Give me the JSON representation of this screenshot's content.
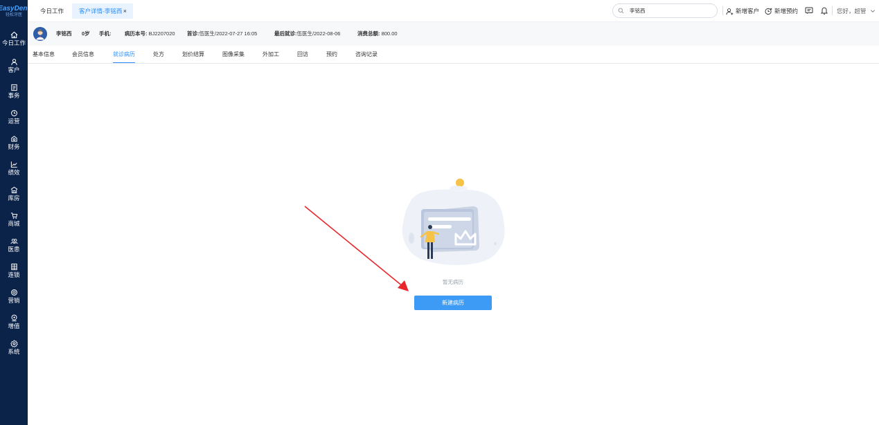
{
  "brand": {
    "name": "EasyDent",
    "subtitle": "轻松牙医"
  },
  "sidebar": {
    "items": [
      {
        "label": "今日工作",
        "icon": "home-icon"
      },
      {
        "label": "客户",
        "icon": "user-icon"
      },
      {
        "label": "事务",
        "icon": "task-icon"
      },
      {
        "label": "运营",
        "icon": "clock-icon"
      },
      {
        "label": "财务",
        "icon": "finance-icon"
      },
      {
        "label": "绩效",
        "icon": "chart-icon"
      },
      {
        "label": "库房",
        "icon": "warehouse-icon"
      },
      {
        "label": "商城",
        "icon": "cart-icon"
      },
      {
        "label": "医患",
        "icon": "users-icon"
      },
      {
        "label": "连锁",
        "icon": "chain-icon"
      },
      {
        "label": "营销",
        "icon": "marketing-icon"
      },
      {
        "label": "增值",
        "icon": "value-added-icon"
      },
      {
        "label": "系统",
        "icon": "gear-icon"
      }
    ]
  },
  "topbar": {
    "tabs": [
      {
        "label": "今日工作",
        "active": false
      },
      {
        "label": "客户详情-李铭西",
        "active": true,
        "close": "×"
      }
    ],
    "search": {
      "value": "李铭西",
      "placeholder": ""
    },
    "add_customer": "新增客户",
    "add_appointment": "新增预约",
    "greeting": "您好，超管"
  },
  "patient": {
    "name": "李铭西",
    "age": "0岁",
    "phone_label": "手机:",
    "phone_value": "",
    "record_no_label": "病历本号:",
    "record_no": "BJ2207020",
    "first_visit_label": "首诊:",
    "first_visit": "伍医生/2022-07-27 16:05",
    "last_visit_label": "最后就诊:",
    "last_visit": "伍医生/2022-08-06",
    "total_spend_label": "消费总额:",
    "total_spend": "800.00"
  },
  "subtabs": [
    {
      "label": "基本信息",
      "active": false
    },
    {
      "label": "会员信息",
      "active": false
    },
    {
      "label": "就诊病历",
      "active": true
    },
    {
      "label": "处方",
      "active": false
    },
    {
      "label": "划价结算",
      "active": false
    },
    {
      "label": "图像采集",
      "active": false
    },
    {
      "label": "外加工",
      "active": false
    },
    {
      "label": "回访",
      "active": false
    },
    {
      "label": "预约",
      "active": false
    },
    {
      "label": "咨询记录",
      "active": false
    }
  ],
  "empty_state": {
    "message": "暂无病历",
    "button": "新建病历"
  },
  "colors": {
    "sidebar_bg": "#0b2249",
    "accent": "#2b8ef5",
    "button": "#3d9bf5",
    "arrow": "#e8262b"
  }
}
